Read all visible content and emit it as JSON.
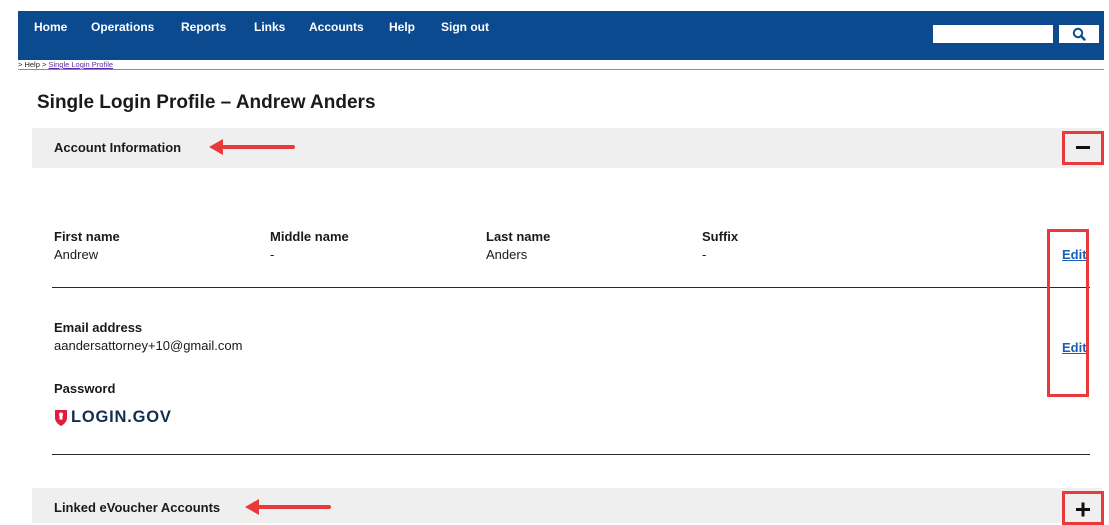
{
  "nav": {
    "items": [
      "Home",
      "Operations",
      "Reports",
      "Links",
      "Accounts",
      "Help",
      "Sign out"
    ],
    "search": {
      "value": "",
      "placeholder": ""
    },
    "search_icon": "search-icon"
  },
  "breadcrumb": {
    "prefix": "> Help > ",
    "current": "Single Login Profile"
  },
  "page": {
    "title": "Single Login Profile – Andrew Anders"
  },
  "account_section": {
    "label": "Account Information",
    "toggle_icon": "minus-icon",
    "expanded": true
  },
  "name_fields": {
    "first_label": "First name",
    "first_value": "Andrew",
    "middle_label": "Middle name",
    "middle_value": "-",
    "last_label": "Last name",
    "last_value": "Anders",
    "suffix_label": "Suffix",
    "suffix_value": "-",
    "edit_label": "Edit"
  },
  "email": {
    "label": "Email address",
    "value": "aandersattorney+10@gmail.com",
    "edit_label": "Edit"
  },
  "password": {
    "label": "Password",
    "provider_logo": "LOGIN.GOV"
  },
  "linked_section": {
    "label": "Linked eVoucher Accounts",
    "toggle_icon": "plus-icon",
    "expanded": false
  },
  "colors": {
    "nav_bg": "#0b4a8f",
    "annotation_red": "#e83a3a",
    "link_blue": "#1a5fb4",
    "logo_red": "#e21c3d",
    "logo_navy": "#112e51"
  }
}
